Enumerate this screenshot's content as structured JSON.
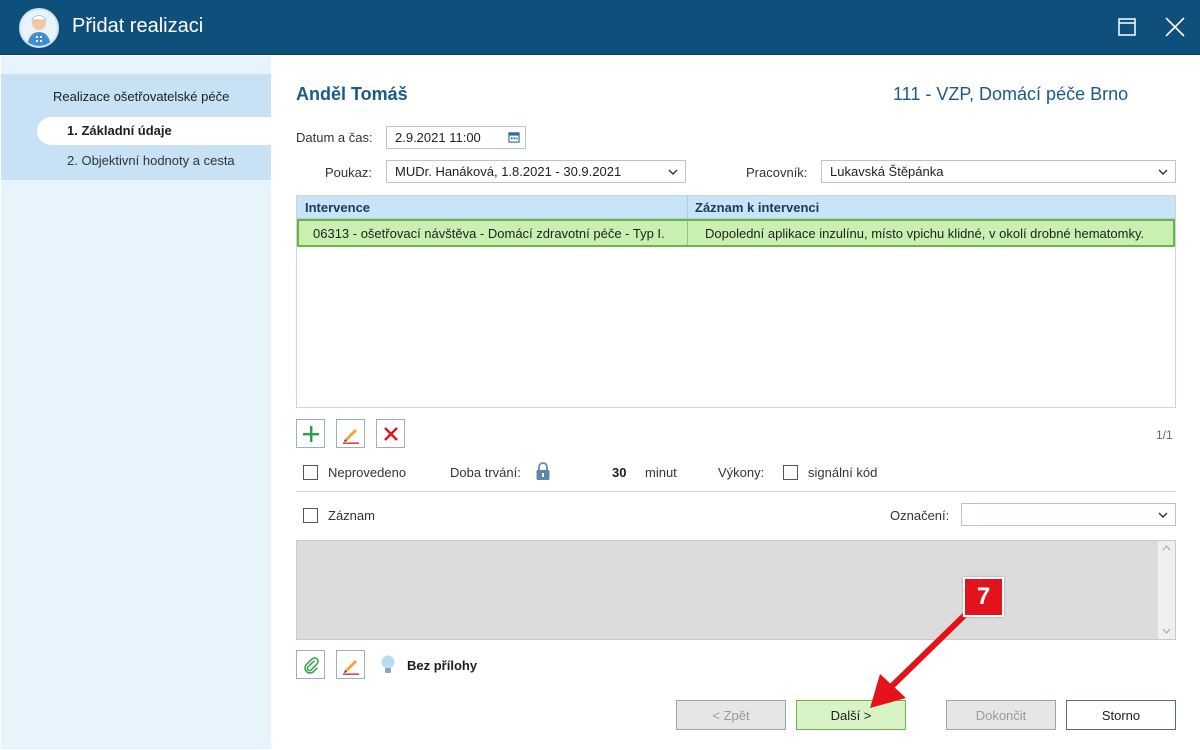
{
  "window": {
    "title": "Přidat realizaci",
    "maximize_icon": "maximize-icon",
    "close_icon": "close-icon"
  },
  "sidebar": {
    "heading": "Realizace ošetřovatelské péče",
    "items": [
      {
        "label": "1. Základní údaje",
        "active": true
      },
      {
        "label": "2. Objektivní hodnoty a cesta",
        "active": false
      }
    ]
  },
  "header": {
    "patient": "Anděl Tomáš",
    "insurance": "111 - VZP, Domácí péče Brno"
  },
  "form": {
    "datetime_label": "Datum a čas:",
    "datetime_value": "2.9.2021 11:00",
    "referral_label": "Poukaz:",
    "referral_value": "MUDr. Hanáková, 1.8.2021 - 30.9.2021",
    "worker_label": "Pracovník:",
    "worker_value": "Lukavská Štěpánka"
  },
  "grid": {
    "columns": [
      "Intervence",
      "Záznam k intervenci"
    ],
    "rows": [
      [
        "06313 - ošetřovací návštěva - Domácí zdravotní péče - Typ I.",
        "Dopolední aplikace inzulínu, místo vpichu klidné, v okolí drobné hematomky."
      ]
    ],
    "pager": "1/1"
  },
  "options": {
    "not_done_label": "Neprovedeno",
    "duration_label": "Doba trvání:",
    "duration_value": "30",
    "duration_unit": "minut",
    "procedures_label": "Výkony:",
    "signal_code_label": "signální kód",
    "record_label": "Záznam",
    "marking_label": "Označení:",
    "marking_value": ""
  },
  "attachments": {
    "label": "Bez přílohy"
  },
  "footer": {
    "back": "< Zpět",
    "next": "Další >",
    "finish": "Dokončit",
    "cancel": "Storno"
  },
  "annotation": {
    "number": "7"
  },
  "colors": {
    "titlebar": "#0f4f7c",
    "accent_blue": "#1a5a8a",
    "selected_row": "#c9f0b1",
    "callout": "#e3121b"
  }
}
